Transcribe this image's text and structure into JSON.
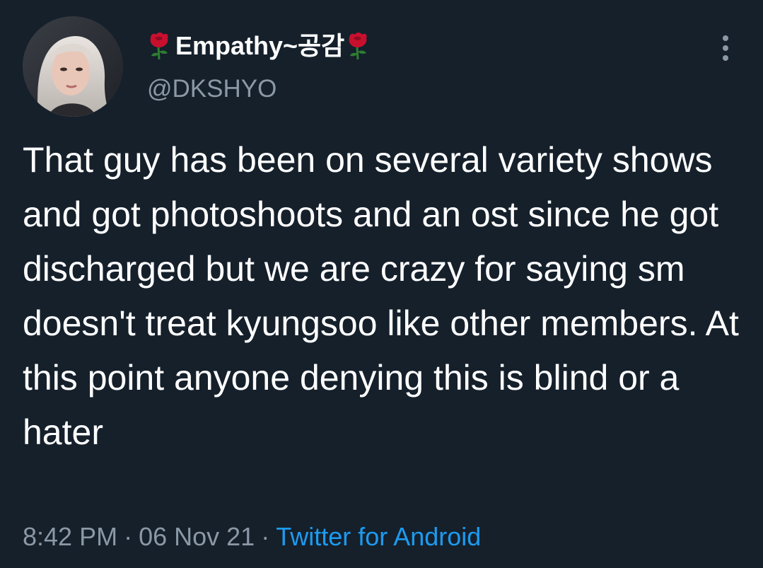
{
  "tweet": {
    "display_name": "Empathy~공감",
    "display_name_emoji": "rose-emoji",
    "handle": "@DKSHYO",
    "text": "That guy has been on several  variety shows and got photoshoots and an ost since he got discharged but we are crazy for saying sm doesn't treat kyungsoo like other members. At this point anyone denying this is blind or a hater",
    "time": "8:42 PM",
    "date": "06 Nov 21",
    "source": "Twitter for Android",
    "separator": "·"
  },
  "icons": {
    "more": "more-vertical-icon",
    "avatar": "profile-photo"
  },
  "colors": {
    "background": "#15202b",
    "text_primary": "#ffffff",
    "text_secondary": "#8b98a5",
    "link": "#1d9bf0",
    "rose": "#c8102e"
  }
}
